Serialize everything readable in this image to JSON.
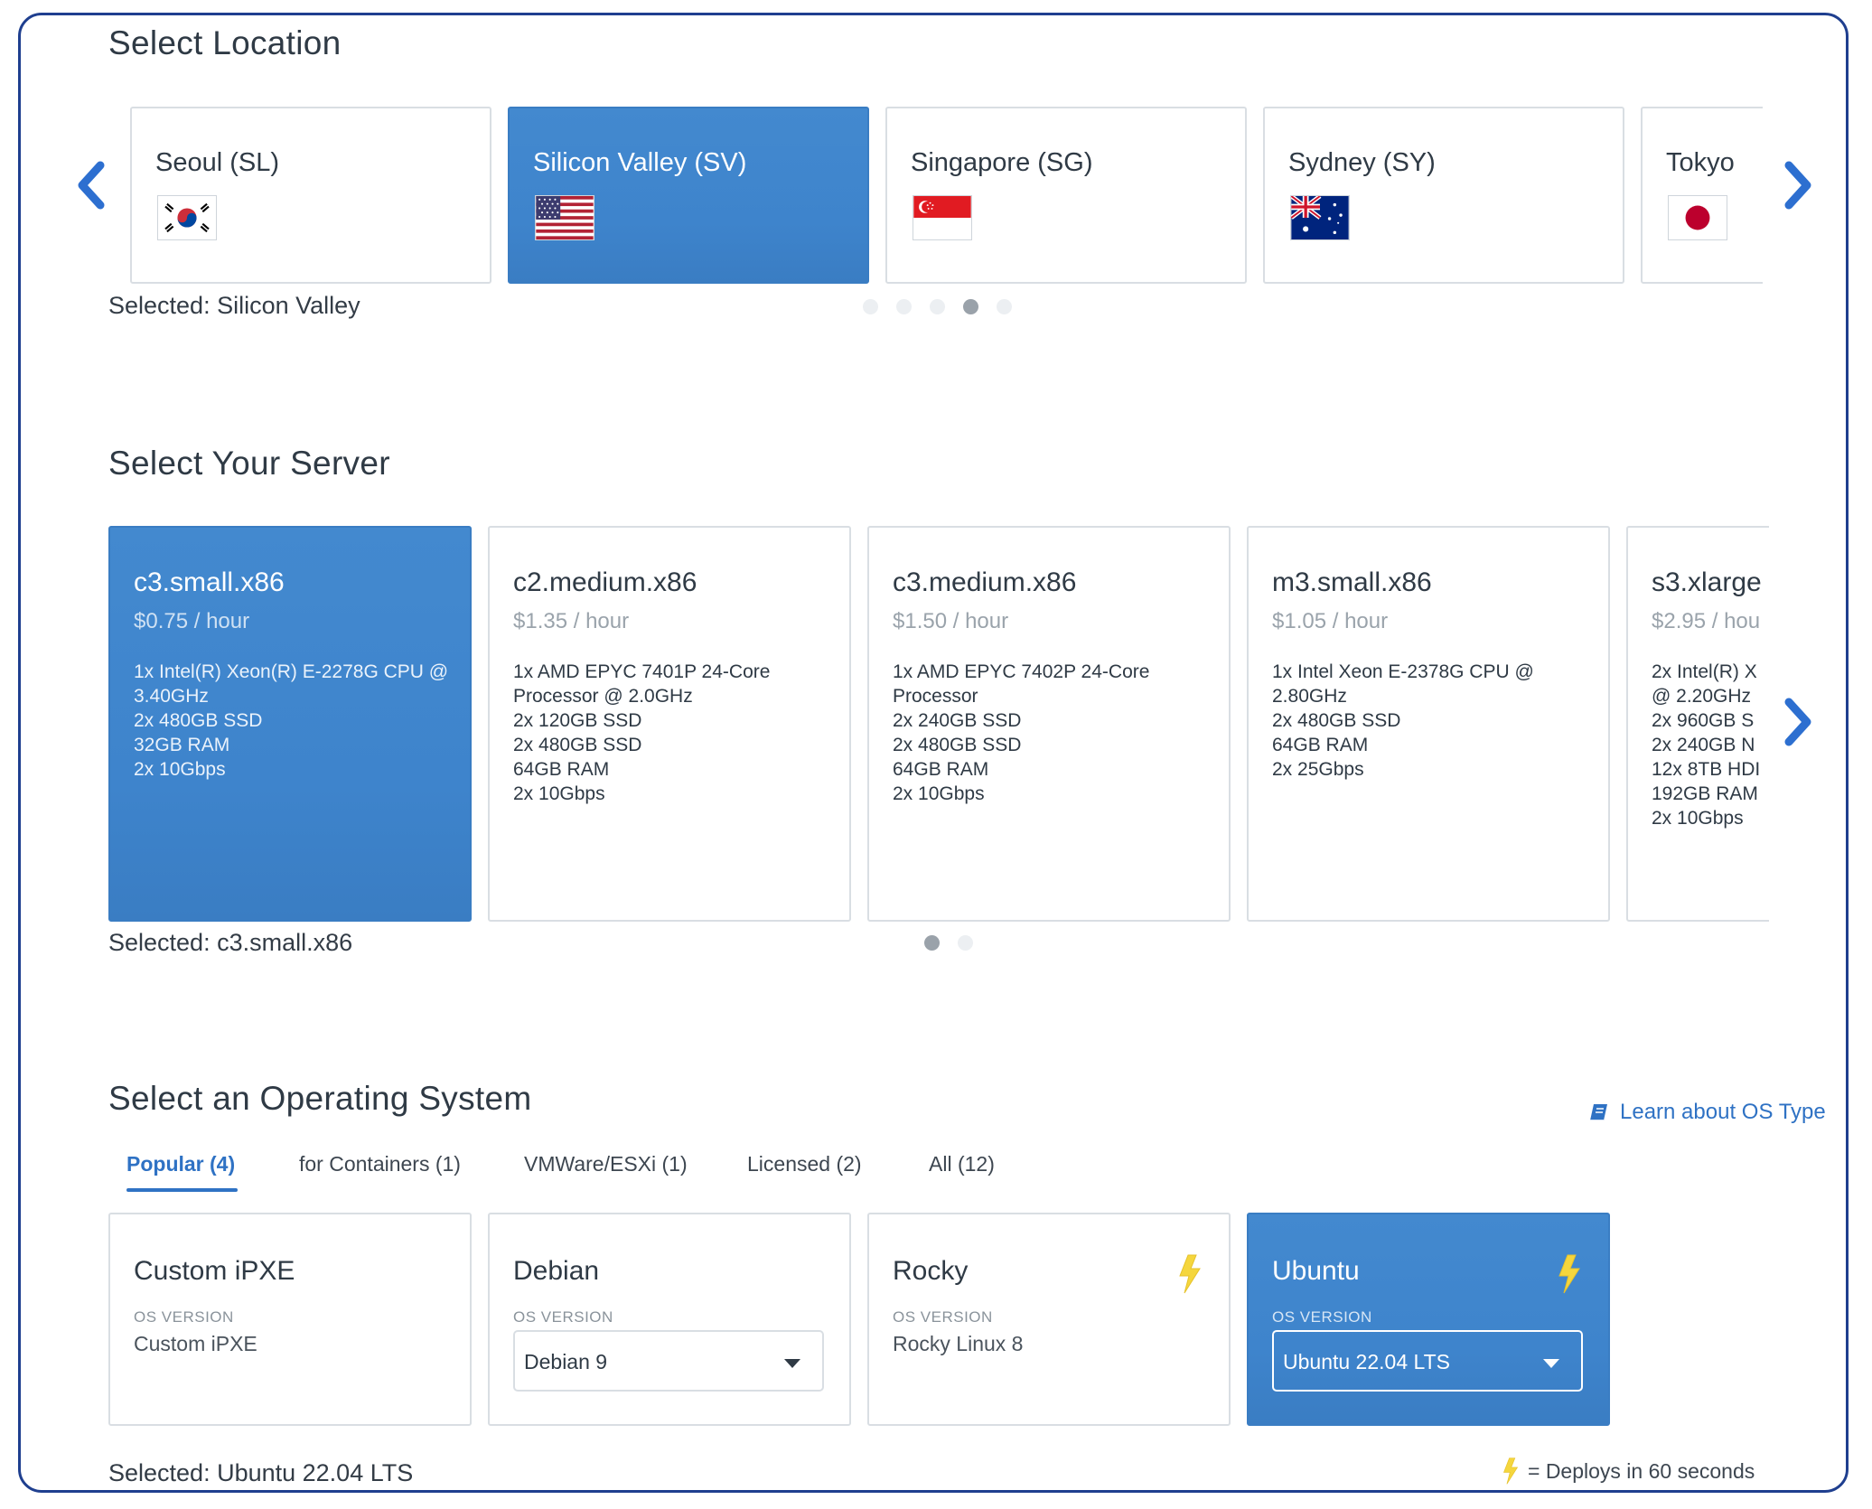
{
  "location": {
    "title": "Select Location",
    "selected_text": "Selected: Silicon Valley",
    "cards": [
      {
        "name": "Seoul (SL)",
        "flag": "south-korea-flag",
        "active": false
      },
      {
        "name": "Silicon Valley (SV)",
        "flag": "usa-flag",
        "active": true
      },
      {
        "name": "Singapore (SG)",
        "flag": "singapore-flag",
        "active": false
      },
      {
        "name": "Sydney (SY)",
        "flag": "australia-flag",
        "active": false
      },
      {
        "name": "Tokyo",
        "flag": "japan-flag",
        "active": false
      }
    ],
    "pagination": {
      "count": 5,
      "current": 4
    }
  },
  "server": {
    "title": "Select Your Server",
    "selected_text": "Selected: c3.small.x86",
    "cards": [
      {
        "name": "c3.small.x86",
        "price": "$0.75 / hour",
        "specs": [
          "1x Intel(R) Xeon(R) E-2278G CPU @",
          "3.40GHz",
          "2x 480GB SSD",
          "32GB RAM",
          "2x 10Gbps"
        ],
        "active": true
      },
      {
        "name": "c2.medium.x86",
        "price": "$1.35 / hour",
        "specs": [
          "1x AMD EPYC 7401P 24-Core",
          "Processor @ 2.0GHz",
          "2x 120GB SSD",
          "2x 480GB SSD",
          "64GB RAM",
          "2x 10Gbps"
        ],
        "active": false
      },
      {
        "name": "c3.medium.x86",
        "price": "$1.50 / hour",
        "specs": [
          "1x AMD EPYC 7402P 24-Core",
          "Processor",
          "2x 240GB SSD",
          "2x 480GB SSD",
          "64GB RAM",
          "2x 10Gbps"
        ],
        "active": false
      },
      {
        "name": "m3.small.x86",
        "price": "$1.05 / hour",
        "specs": [
          "1x Intel Xeon E-2378G CPU @",
          "2.80GHz",
          "2x 480GB SSD",
          "64GB RAM",
          "2x 25Gbps"
        ],
        "active": false
      },
      {
        "name": "s3.xlarge",
        "price": "$2.95 / hou",
        "specs": [
          "2x Intel(R) X",
          "@ 2.20GHz",
          "2x 960GB S",
          "2x 240GB N",
          "12x 8TB HDI",
          "192GB RAM",
          "2x 10Gbps"
        ],
        "active": false
      }
    ],
    "pagination": {
      "count": 2,
      "current": 1
    }
  },
  "os": {
    "title": "Select an Operating System",
    "learn_link": "Learn about OS Type",
    "tabs": [
      "Popular (4)",
      "for Containers (1)",
      "VMWare/ESXi (1)",
      "Licensed (2)",
      "All (12)"
    ],
    "active_tab": 0,
    "version_label": "OS VERSION",
    "cards": [
      {
        "name": "Custom iPXE",
        "version": "Custom iPXE",
        "dropdown": false,
        "fast": false,
        "active": false
      },
      {
        "name": "Debian",
        "version": "Debian 9",
        "dropdown": true,
        "fast": false,
        "active": false
      },
      {
        "name": "Rocky",
        "version": "Rocky Linux 8",
        "dropdown": false,
        "fast": true,
        "active": false
      },
      {
        "name": "Ubuntu",
        "version": "Ubuntu 22.04 LTS",
        "dropdown": true,
        "fast": true,
        "active": true
      }
    ],
    "selected_text": "Selected: Ubuntu 22.04 LTS",
    "legend_text": "= Deploys in 60 seconds"
  },
  "colors": {
    "accent": "#3e84cc",
    "link": "#2f72c4",
    "bolt": "#f5d63d",
    "frame": "#1f3f8f"
  }
}
